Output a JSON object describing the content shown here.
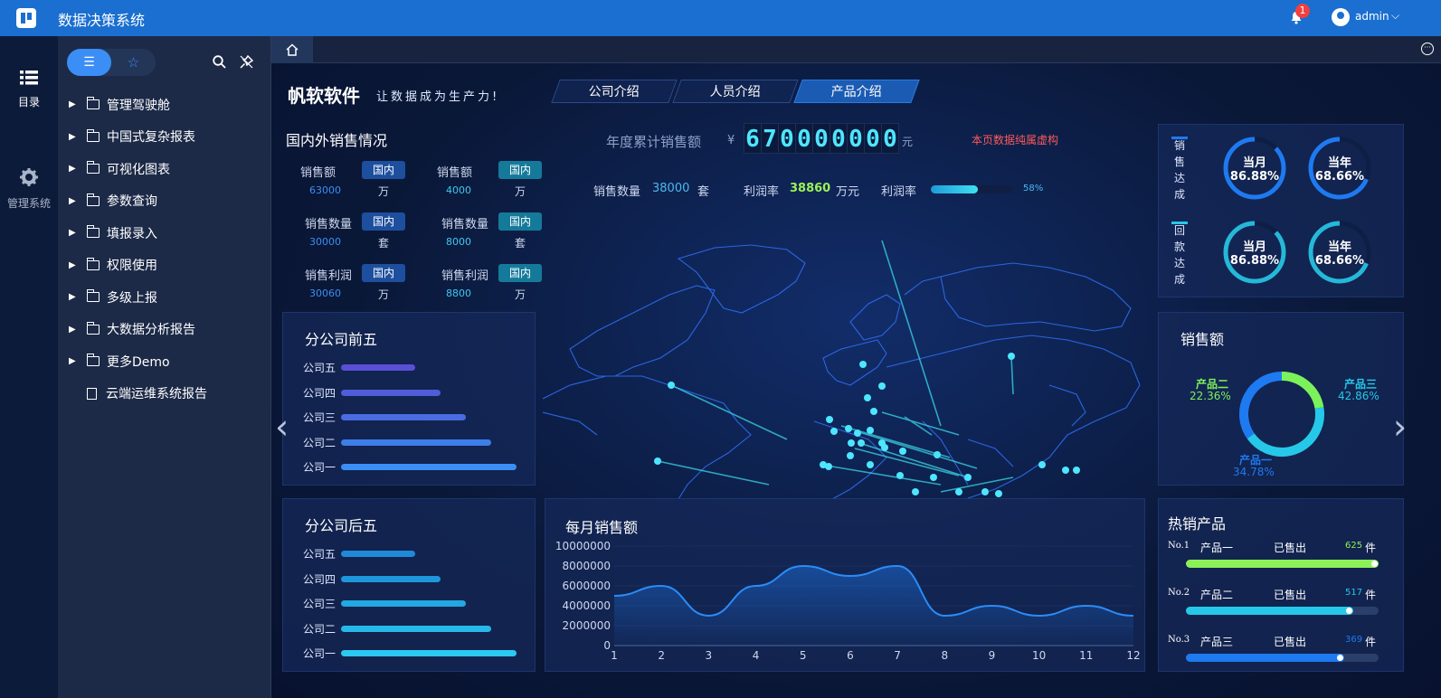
{
  "app": {
    "title": "数据决策系统",
    "notifications": "1",
    "user": "admin"
  },
  "rail": [
    {
      "label": "目录"
    },
    {
      "label": "管理系统"
    }
  ],
  "tree": {
    "items": [
      {
        "label": "管理驾驶舱",
        "type": "folder"
      },
      {
        "label": "中国式复杂报表",
        "type": "folder"
      },
      {
        "label": "可视化图表",
        "type": "folder"
      },
      {
        "label": "参数查询",
        "type": "folder"
      },
      {
        "label": "填报录入",
        "type": "folder"
      },
      {
        "label": "权限使用",
        "type": "folder"
      },
      {
        "label": "多级上报",
        "type": "folder"
      },
      {
        "label": "大数据分析报告",
        "type": "folder"
      },
      {
        "label": "更多Demo",
        "type": "folder"
      },
      {
        "label": "云端运维系统报告",
        "type": "doc"
      }
    ]
  },
  "dashboard": {
    "brand": "帆软软件",
    "slogan": "让数据成为生产力!",
    "tabs": [
      {
        "label": "公司介绍"
      },
      {
        "label": "人员介绍"
      },
      {
        "label": "产品介绍"
      }
    ],
    "active_tab": 2,
    "domestic": {
      "title": "国内外销售情况",
      "rows": [
        {
          "label": "销售额",
          "left_value": "63000",
          "right_value": "4000",
          "unit": "万"
        },
        {
          "label": "销售数量",
          "left_value": "30000",
          "right_value": "8000",
          "unit": "套"
        },
        {
          "label": "销售利润",
          "left_value": "30060",
          "right_value": "8800",
          "unit": "万"
        }
      ],
      "pill": "国内"
    },
    "kpi": {
      "annual_label": "年度累计销售额",
      "currency": "¥",
      "digits": [
        "6",
        "7",
        "0",
        "0",
        "0",
        "0",
        "0",
        "0",
        "0"
      ],
      "unit": "元",
      "note": "本页数据纯属虚构",
      "qty_label": "销售数量",
      "qty_value": "38000",
      "qty_unit": "套",
      "profit_label": "利润率",
      "profit_value": "38860",
      "profit_unit": "万元",
      "rate_label": "利润率",
      "rate_value": "58%",
      "rate_fraction": 0.58
    },
    "top5": {
      "title": "分公司前五",
      "items": [
        {
          "label": "公司五",
          "v": 0.41
        },
        {
          "label": "公司四",
          "v": 0.55
        },
        {
          "label": "公司三",
          "v": 0.69
        },
        {
          "label": "公司二",
          "v": 0.83
        },
        {
          "label": "公司一",
          "v": 0.97
        }
      ]
    },
    "bottom5": {
      "title": "分公司后五",
      "items": [
        {
          "label": "公司五",
          "v": 0.41
        },
        {
          "label": "公司四",
          "v": 0.55
        },
        {
          "label": "公司三",
          "v": 0.69
        },
        {
          "label": "公司二",
          "v": 0.83
        },
        {
          "label": "公司一",
          "v": 0.97
        }
      ]
    },
    "gauges": {
      "sales_label": "销售达成",
      "collect_label": "回款达成",
      "items": [
        {
          "label": "当月",
          "value": "86.88%",
          "fraction": 0.8688
        },
        {
          "label": "当年",
          "value": "68.66%",
          "fraction": 0.6866
        },
        {
          "label": "当月",
          "value": "86.88%",
          "fraction": 0.8688
        },
        {
          "label": "当年",
          "value": "68.66%",
          "fraction": 0.6866
        }
      ]
    },
    "donut": {
      "title": "销售额",
      "slices": [
        {
          "name": "产品二",
          "value": "22.36%",
          "fraction": 0.2236,
          "color": "#7cf25a"
        },
        {
          "name": "产品三",
          "value": "42.86%",
          "fraction": 0.4286,
          "color": "#25c8e8"
        },
        {
          "name": "产品一",
          "value": "34.78%",
          "fraction": 0.3478,
          "color": "#1e7af0"
        }
      ]
    },
    "hot": {
      "title": "热销产品",
      "sold_label": "已售出",
      "unit": "件",
      "items": [
        {
          "rank": "No.1",
          "name": "产品一",
          "count": "625",
          "fraction": 1.0,
          "color": "#8cf058"
        },
        {
          "rank": "No.2",
          "name": "产品二",
          "count": "517",
          "fraction": 0.87,
          "color": "#25c8e8"
        },
        {
          "rank": "No.3",
          "name": "产品三",
          "count": "369",
          "fraction": 0.82,
          "color": "#1e7af0"
        }
      ]
    }
  },
  "chart_data": {
    "type": "area",
    "title": "每月销售额",
    "x": [
      1,
      2,
      3,
      4,
      5,
      6,
      7,
      8,
      9,
      10,
      11,
      12
    ],
    "series": [
      {
        "values": [
          5000000,
          6000000,
          3000000,
          6000000,
          8000000,
          7000000,
          8000000,
          3000000,
          4000000,
          3000000,
          4000000,
          3000000
        ]
      }
    ],
    "ylim": [
      0,
      10000000
    ],
    "yticks": [
      "10000000",
      "8000000",
      "6000000",
      "4000000",
      "2000000",
      "0"
    ],
    "xticks": [
      "1",
      "2",
      "3",
      "4",
      "5",
      "6",
      "7",
      "8",
      "9",
      "10",
      "11",
      "12"
    ]
  }
}
